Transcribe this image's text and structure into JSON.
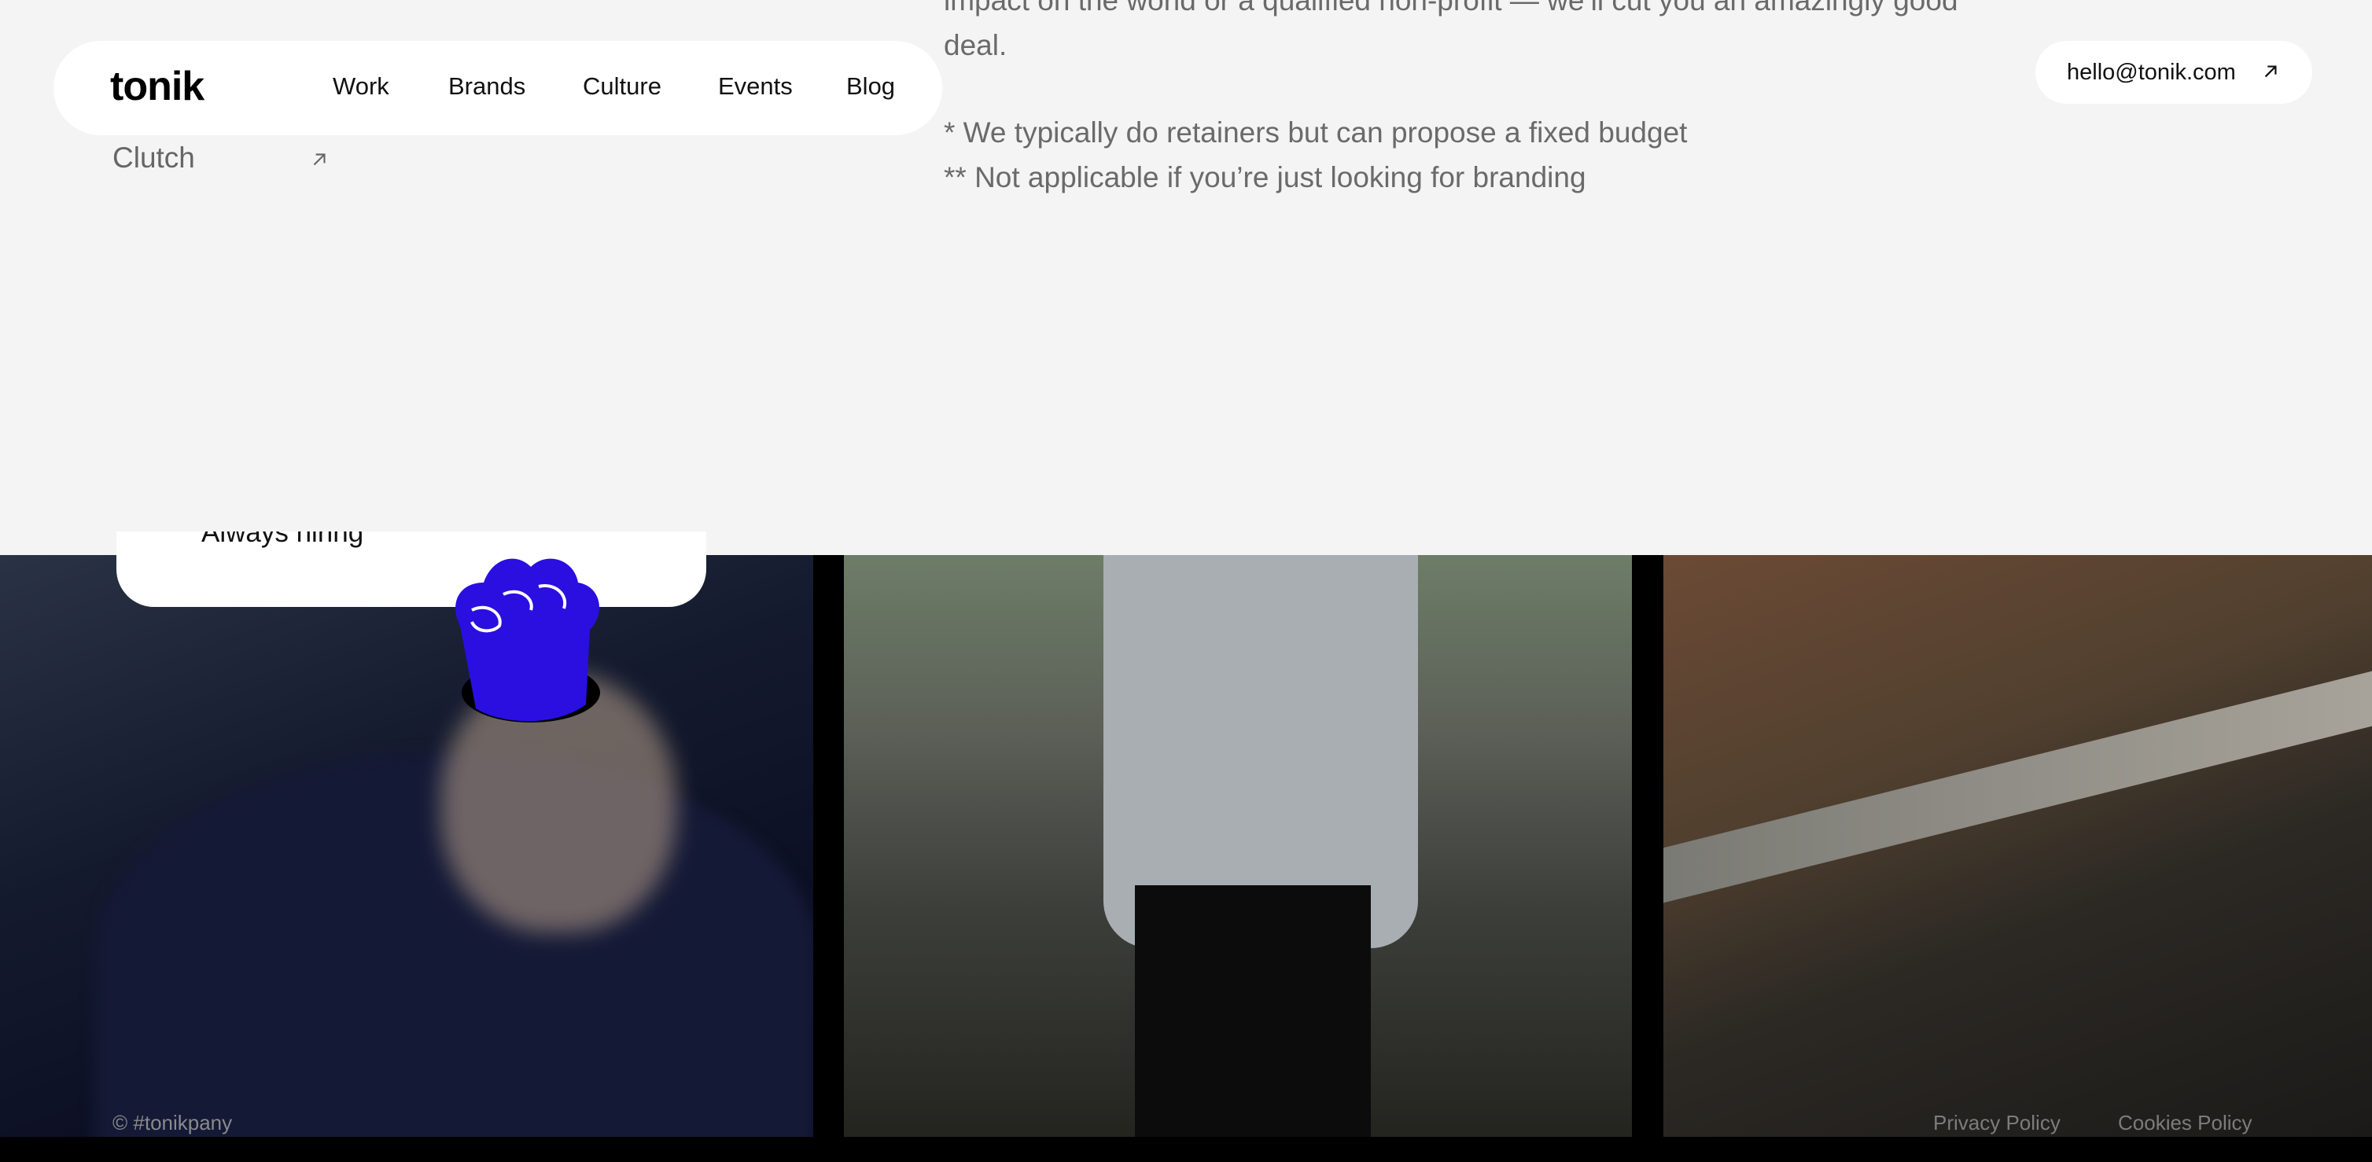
{
  "header": {
    "logo": "tonik",
    "nav": [
      "Work",
      "Brands",
      "Culture",
      "Events",
      "Blog"
    ],
    "email": "hello@tonik.com"
  },
  "content": {
    "line_partial": "impact on the world or a qualified non-profit — we’ll cut you an amazingly good",
    "line_deal": "deal.",
    "footnote1": "* We typically do retainers but can propose a fixed budget",
    "footnote2": "** Not applicable if you’re just looking for branding",
    "clutch": "Clutch"
  },
  "hiring": {
    "label": "Always hiring"
  },
  "footer": {
    "copyright": "© #tonikpany",
    "privacy": "Privacy Policy",
    "cookies": "Cookies Policy"
  },
  "colors": {
    "page_bg": "#f4f4f4",
    "fist_blue": "#2a0fe0",
    "pill_bg": "#ffffff"
  }
}
